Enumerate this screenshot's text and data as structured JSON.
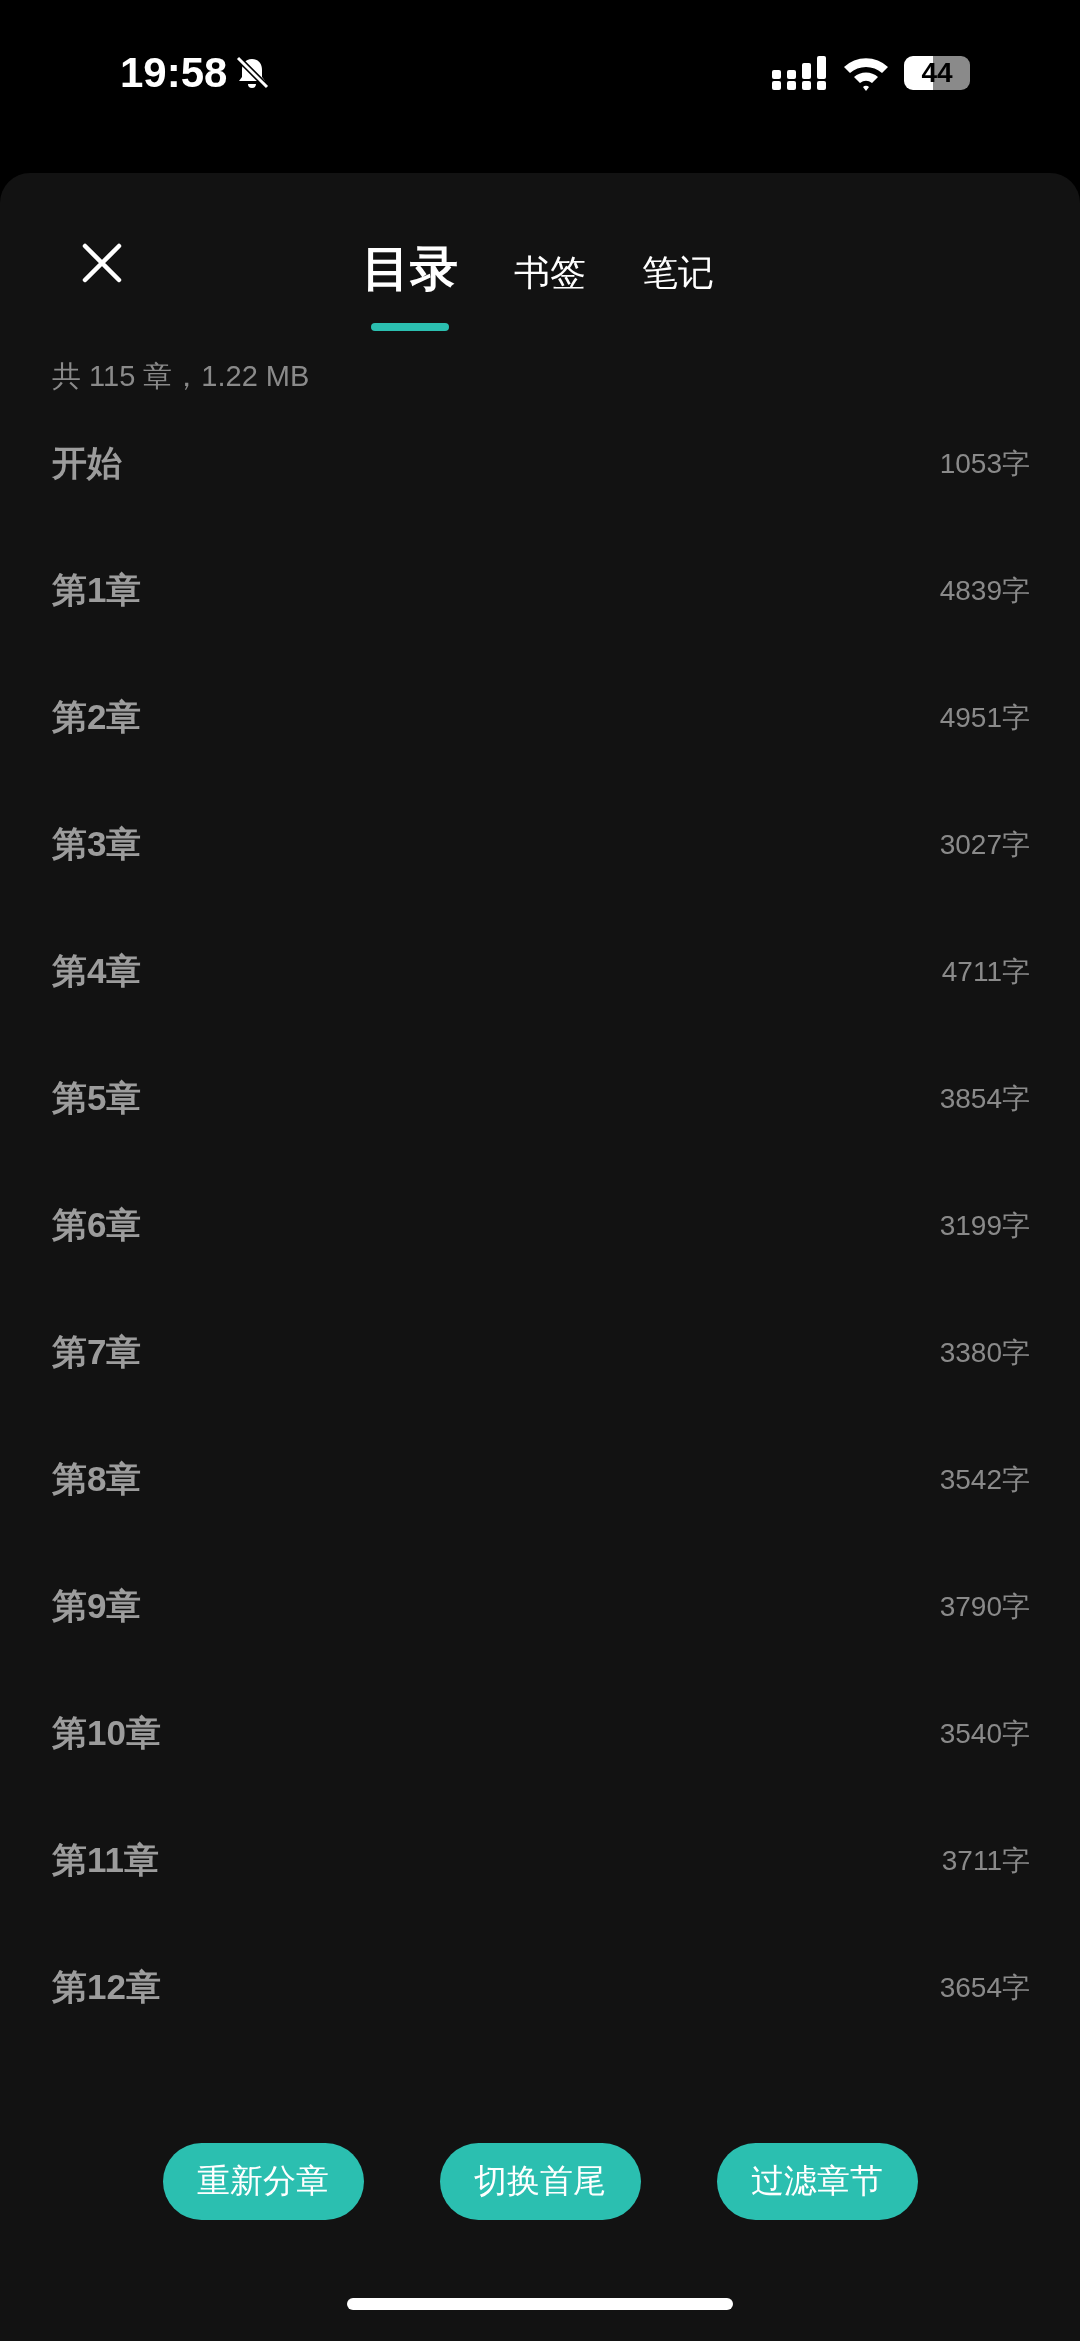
{
  "status_bar": {
    "time": "19:58",
    "silent": true,
    "battery": "44"
  },
  "tabs": [
    {
      "label": "目录",
      "selected": true
    },
    {
      "label": "书签",
      "selected": false
    },
    {
      "label": "笔记",
      "selected": false
    }
  ],
  "summary": "共 115 章，1.22 MB",
  "chapters": [
    {
      "title": "开始",
      "count": "1053字"
    },
    {
      "title": "第1章",
      "count": "4839字"
    },
    {
      "title": "第2章",
      "count": "4951字"
    },
    {
      "title": "第3章",
      "count": "3027字"
    },
    {
      "title": "第4章",
      "count": "4711字"
    },
    {
      "title": "第5章",
      "count": "3854字"
    },
    {
      "title": "第6章",
      "count": "3199字"
    },
    {
      "title": "第7章",
      "count": "3380字"
    },
    {
      "title": "第8章",
      "count": "3542字"
    },
    {
      "title": "第9章",
      "count": "3790字"
    },
    {
      "title": "第10章",
      "count": "3540字"
    },
    {
      "title": "第11章",
      "count": "3711字"
    },
    {
      "title": "第12章",
      "count": "3654字"
    }
  ],
  "buttons": [
    "重新分章",
    "切换首尾",
    "过滤章节"
  ]
}
